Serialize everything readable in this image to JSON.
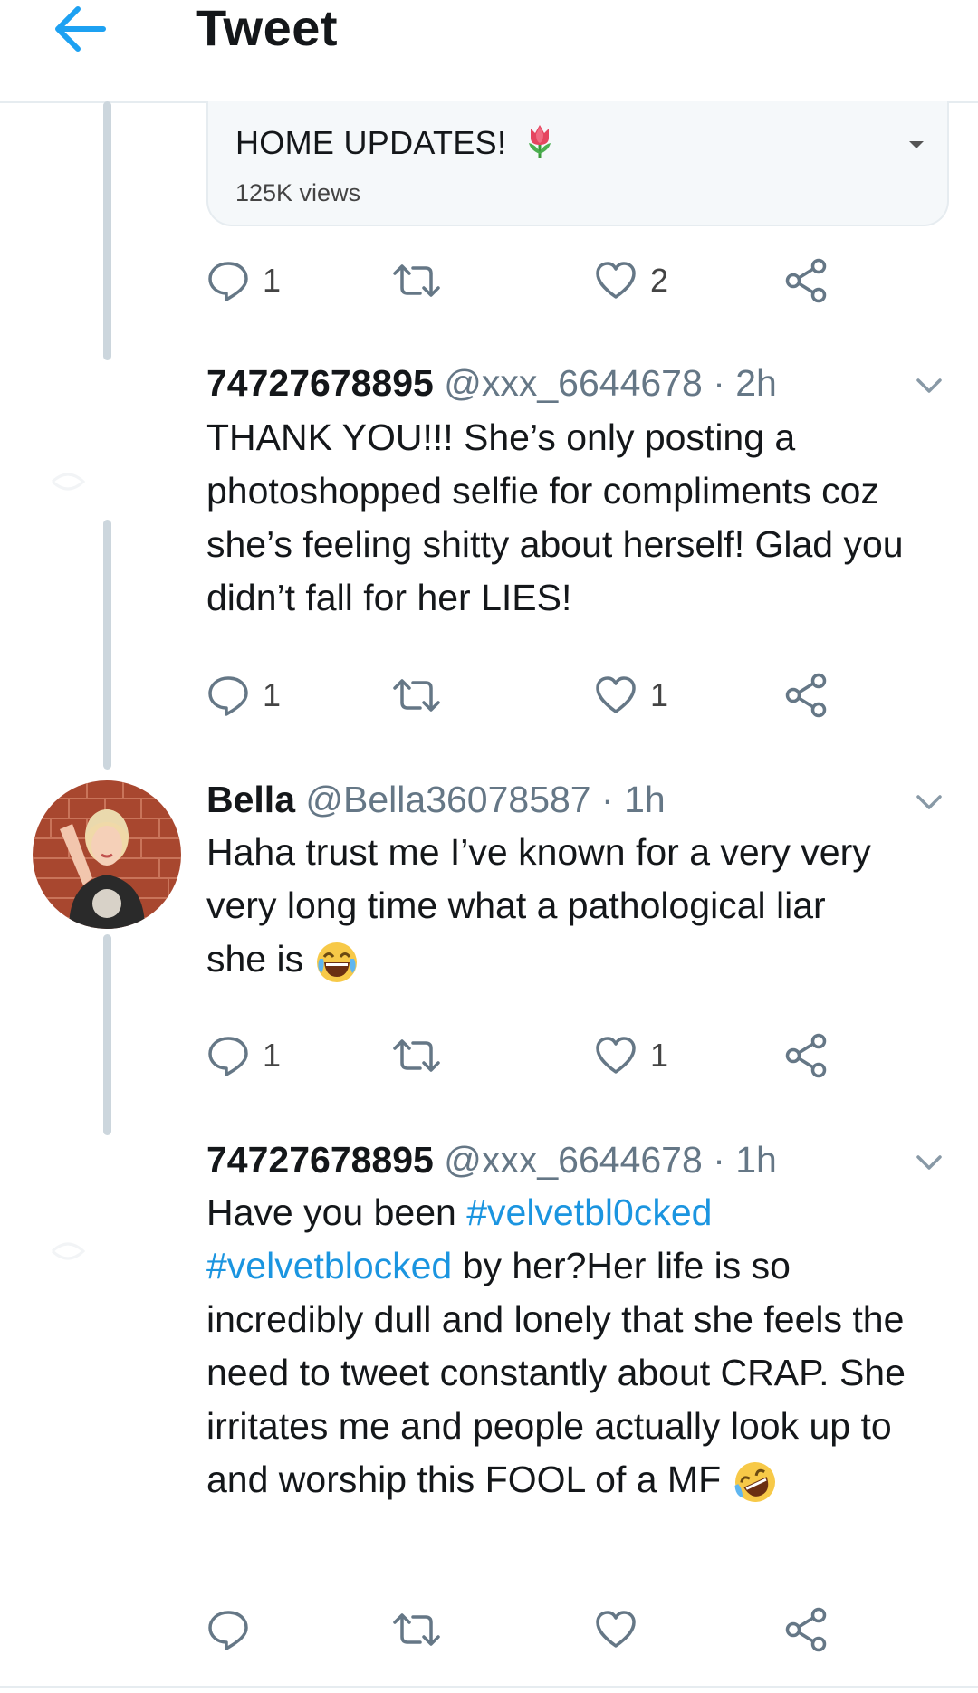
{
  "header": {
    "title": "Tweet"
  },
  "poll": {
    "title": "HOME UPDATES!",
    "emoji": "🌷",
    "views": "125K views"
  },
  "top_actions": {
    "replies": "1",
    "retweets": "",
    "likes": "2"
  },
  "tweets": [
    {
      "display_name": "74727678895",
      "handle": "@xxx_6644678",
      "time": "· 2h",
      "text": "THANK YOU!!! She’s only posting a photoshopped selfie for compliments coz she’s feeling shitty about herself! Glad you didn’t fall for her LIES!",
      "replies": "1",
      "retweets": "",
      "likes": "1"
    },
    {
      "display_name": "Bella",
      "handle": "@Bella36078587",
      "time": "· 1h",
      "text_lines": [
        "Haha trust me I’ve known for a very very",
        "very long time what a pathological liar",
        "she is"
      ],
      "emoji": "😂",
      "replies": "1",
      "retweets": "",
      "likes": "1"
    },
    {
      "display_name": "74727678895",
      "handle": "@xxx_6644678",
      "time": "· 1h",
      "text_before": "Have you been",
      "hashtag1": "#velvetbl0cked",
      "hashtag2": "#velvetblocked",
      "text_after": "by her?Her life is so incredibly dull and lonely that she feels the need to tweet constantly about CRAP. She irritates me and people actually look up to and worship this FOOL of a MF",
      "emoji": "🤣",
      "replies": "",
      "retweets": "",
      "likes": ""
    }
  ],
  "colors": {
    "accent": "#1da1f2",
    "hashtag": "#1b95e0",
    "icon": "#657786",
    "thread_line": "#ccd6dd"
  }
}
